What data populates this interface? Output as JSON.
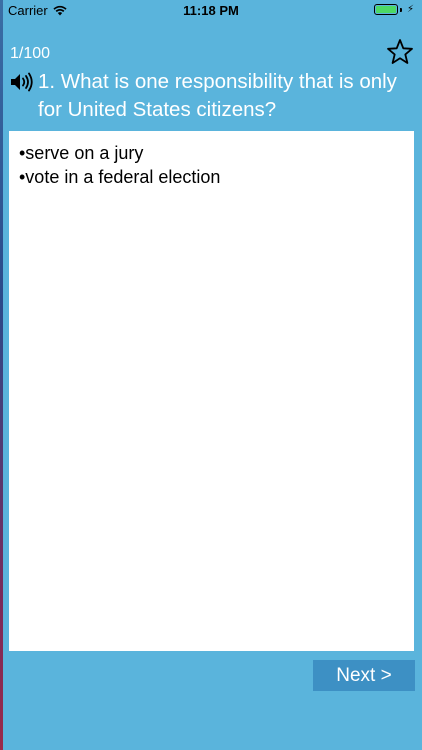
{
  "status_bar": {
    "carrier": "Carrier",
    "time": "11:18 PM",
    "battery_color": "#4cd964"
  },
  "header": {
    "counter": "1/100",
    "favorite_icon": "star-outline-icon",
    "audio_icon": "speaker-icon"
  },
  "question": {
    "text": "1. What is one responsibility that is only for United States citizens?"
  },
  "answers": [
    "•serve on a jury",
    "•vote in a federal election"
  ],
  "footer": {
    "next_label": "Next >"
  },
  "colors": {
    "background": "#5ab4dc",
    "next_button": "#3d90c4"
  }
}
